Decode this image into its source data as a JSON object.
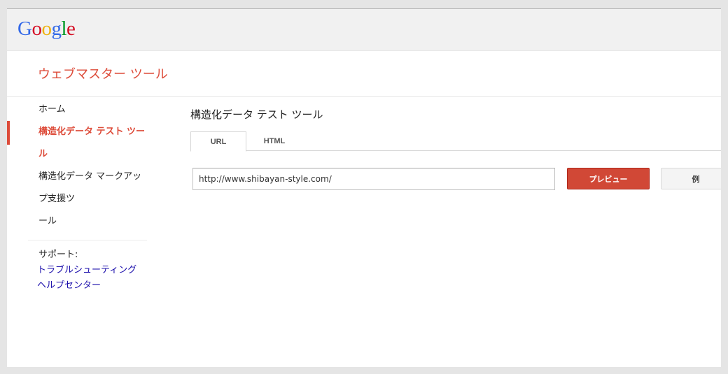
{
  "header": {
    "logo_letters": [
      "G",
      "o",
      "o",
      "g",
      "l",
      "e"
    ],
    "logo_colors": [
      "#3369e8",
      "#d50f25",
      "#eeb211",
      "#3369e8",
      "#009925",
      "#d50f25"
    ]
  },
  "product": {
    "title": "ウェブマスター ツール"
  },
  "sidebar": {
    "items": [
      {
        "label": "ホーム"
      },
      {
        "label": "構造化データ テスト ツール"
      },
      {
        "label": "構造化データ マークアップ支援ツ"
      },
      {
        "label": "ール"
      }
    ],
    "support_label": "サポート:",
    "support_links": [
      {
        "label": "トラブルシューティング"
      },
      {
        "label": "ヘルプセンター"
      }
    ]
  },
  "main": {
    "title": "構造化データ テスト ツール",
    "tabs": [
      {
        "label": "URL"
      },
      {
        "label": "HTML"
      }
    ],
    "url_input_value": "http://www.shibayan-style.com/",
    "preview_button": "プレビュー",
    "example_button": "例"
  },
  "colors": {
    "accent": "#dd4b39",
    "link": "#1a0dab"
  }
}
